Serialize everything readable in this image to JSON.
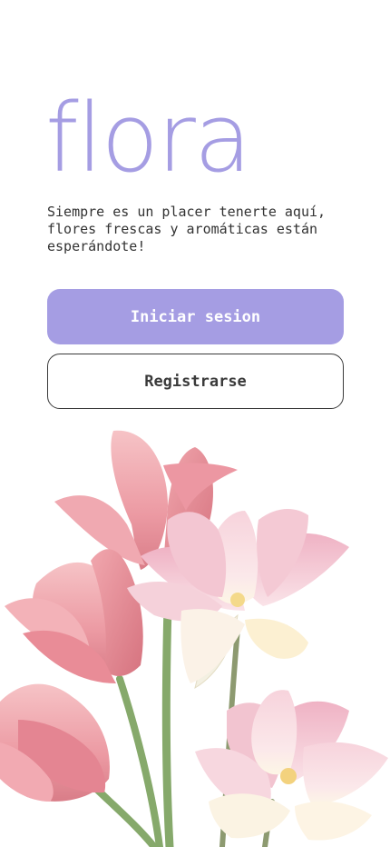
{
  "app": {
    "logo": "flora",
    "tagline": "Siempre es un placer tenerte aquí,\nflores frescas y aromáticas están\nesperándote!"
  },
  "actions": {
    "login_label": "Iniciar sesion",
    "register_label": "Registrarse"
  },
  "colors": {
    "accent": "#a59de3",
    "text": "#333333",
    "background": "#ffffff"
  },
  "hero_image": {
    "icon": "flower-bouquet-illustration"
  }
}
